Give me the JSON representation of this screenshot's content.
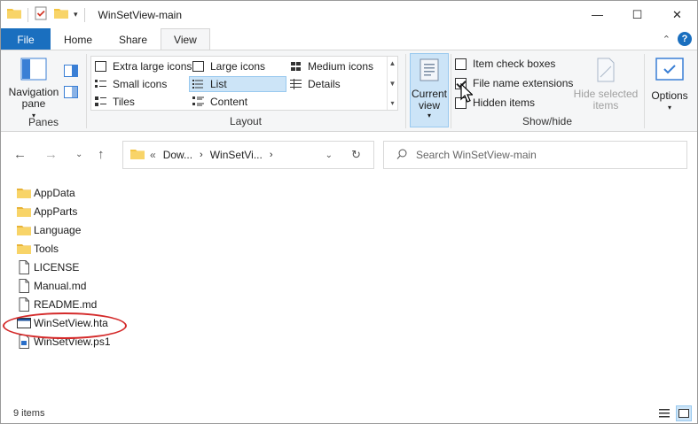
{
  "window": {
    "title": "WinSetView-main",
    "controls": {
      "minimize": "—",
      "maximize": "☐",
      "close": "✕"
    }
  },
  "tabs": [
    {
      "label": "File"
    },
    {
      "label": "Home"
    },
    {
      "label": "Share"
    },
    {
      "label": "View"
    }
  ],
  "ribbon": {
    "panes": {
      "group_label": "Panes",
      "navigation_pane": "Navigation\npane",
      "navigation_pane_line1": "Navigation",
      "navigation_pane_line2": "pane"
    },
    "layout": {
      "group_label": "Layout",
      "items": [
        {
          "label": "Extra large icons"
        },
        {
          "label": "Large icons"
        },
        {
          "label": "Medium icons"
        },
        {
          "label": "Small icons"
        },
        {
          "label": "List"
        },
        {
          "label": "Details"
        },
        {
          "label": "Tiles"
        },
        {
          "label": "Content"
        }
      ],
      "selected": "List"
    },
    "current_view": {
      "line1": "Current",
      "line2": "view"
    },
    "show_hide": {
      "group_label": "Show/hide",
      "item_check_boxes": {
        "label": "Item check boxes",
        "checked": false
      },
      "file_name_extensions": {
        "label": "File name extensions",
        "checked": true
      },
      "hidden_items": {
        "label": "Hidden items",
        "checked": false
      },
      "hide_selected_line1": "Hide selected",
      "hide_selected_line2": "items"
    },
    "options": {
      "label": "Options"
    }
  },
  "address": {
    "prefix": "«",
    "segments": [
      "Dow...",
      "WinSetVi..."
    ],
    "search_placeholder": "Search WinSetView-main"
  },
  "files": [
    {
      "name": "AppData",
      "type": "folder"
    },
    {
      "name": "AppParts",
      "type": "folder"
    },
    {
      "name": "Language",
      "type": "folder"
    },
    {
      "name": "Tools",
      "type": "folder"
    },
    {
      "name": "LICENSE",
      "type": "file"
    },
    {
      "name": "Manual.md",
      "type": "file"
    },
    {
      "name": "README.md",
      "type": "file"
    },
    {
      "name": "WinSetView.hta",
      "type": "hta",
      "highlighted": true
    },
    {
      "name": "WinSetView.ps1",
      "type": "ps1"
    }
  ],
  "status": {
    "item_count": "9 items"
  },
  "colors": {
    "accent": "#1a6fbf",
    "selection": "#cce4f7",
    "highlight_ring": "#d42a2a",
    "folder": "#f4c542"
  }
}
